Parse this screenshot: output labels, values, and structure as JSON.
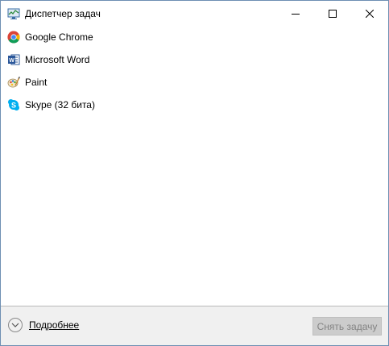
{
  "window": {
    "title": "Диспетчер задач",
    "icon": "task-manager-icon",
    "controls": [
      "minimize",
      "maximize",
      "close"
    ]
  },
  "tasks": [
    {
      "label": "Google Chrome",
      "icon": "chrome-icon"
    },
    {
      "label": "Microsoft Word",
      "icon": "word-icon"
    },
    {
      "label": "Paint",
      "icon": "paint-icon"
    },
    {
      "label": "Skype (32 бита)",
      "icon": "skype-icon"
    }
  ],
  "footer": {
    "details_label": "Подробнее",
    "end_task_label": "Снять задачу",
    "end_task_enabled": false
  },
  "colors": {
    "window_border": "#6e8fb3",
    "footer_bg": "#f0f0f0",
    "button_disabled_bg": "#cccccc",
    "button_disabled_text": "#838383"
  }
}
